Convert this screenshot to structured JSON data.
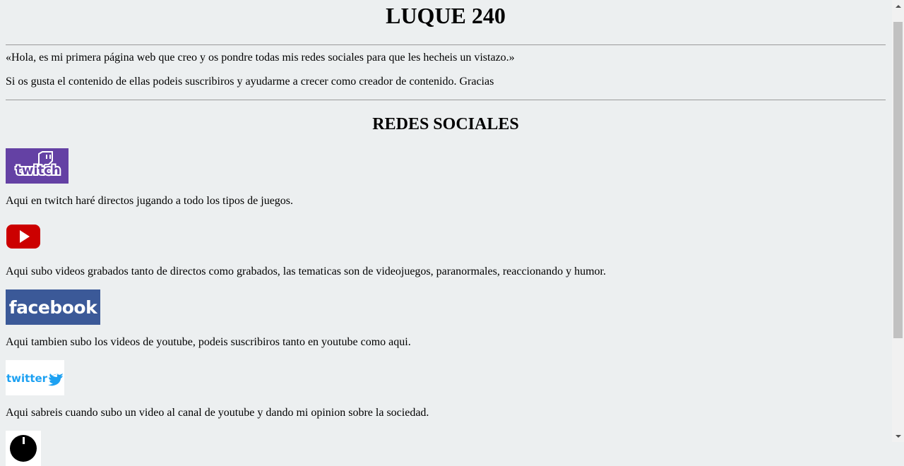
{
  "page": {
    "title": "LUQUE 240",
    "intro": "«Hola, es mi primera página web que creo y os pondre todas mis redes sociales para que les hecheis un vistazo.»",
    "subscribe": "Si os gusta el contenido de ellas podeis suscribiros y ayudarme a crecer como creador de contenido. Gracias",
    "section_title": "REDES SOCIALES"
  },
  "networks": [
    {
      "name": "twitch",
      "logo_text": "twitch",
      "color": "#6441a4",
      "description": "Aqui en twitch haré directos jugando a todo los tipos de juegos."
    },
    {
      "name": "youtube",
      "logo_text": "",
      "color": "#cc0000",
      "description": "Aqui subo videos grabados tanto de directos como grabados, las tematicas son de videojuegos, paranormales, reaccionando y humor."
    },
    {
      "name": "facebook",
      "logo_text": "facebook",
      "color": "#3b5998",
      "description": "Aqui tambien subo los videos de youtube, podeis suscribiros tanto en youtube como aqui."
    },
    {
      "name": "twitter",
      "logo_text": "twitter",
      "color": "#1da1f2",
      "description": "Aqui sabreis cuando subo un video al canal de youtube y dando mi opinion sobre la sociedad."
    },
    {
      "name": "tiktok",
      "logo_text": "",
      "color": "#000000",
      "description": ""
    }
  ]
}
